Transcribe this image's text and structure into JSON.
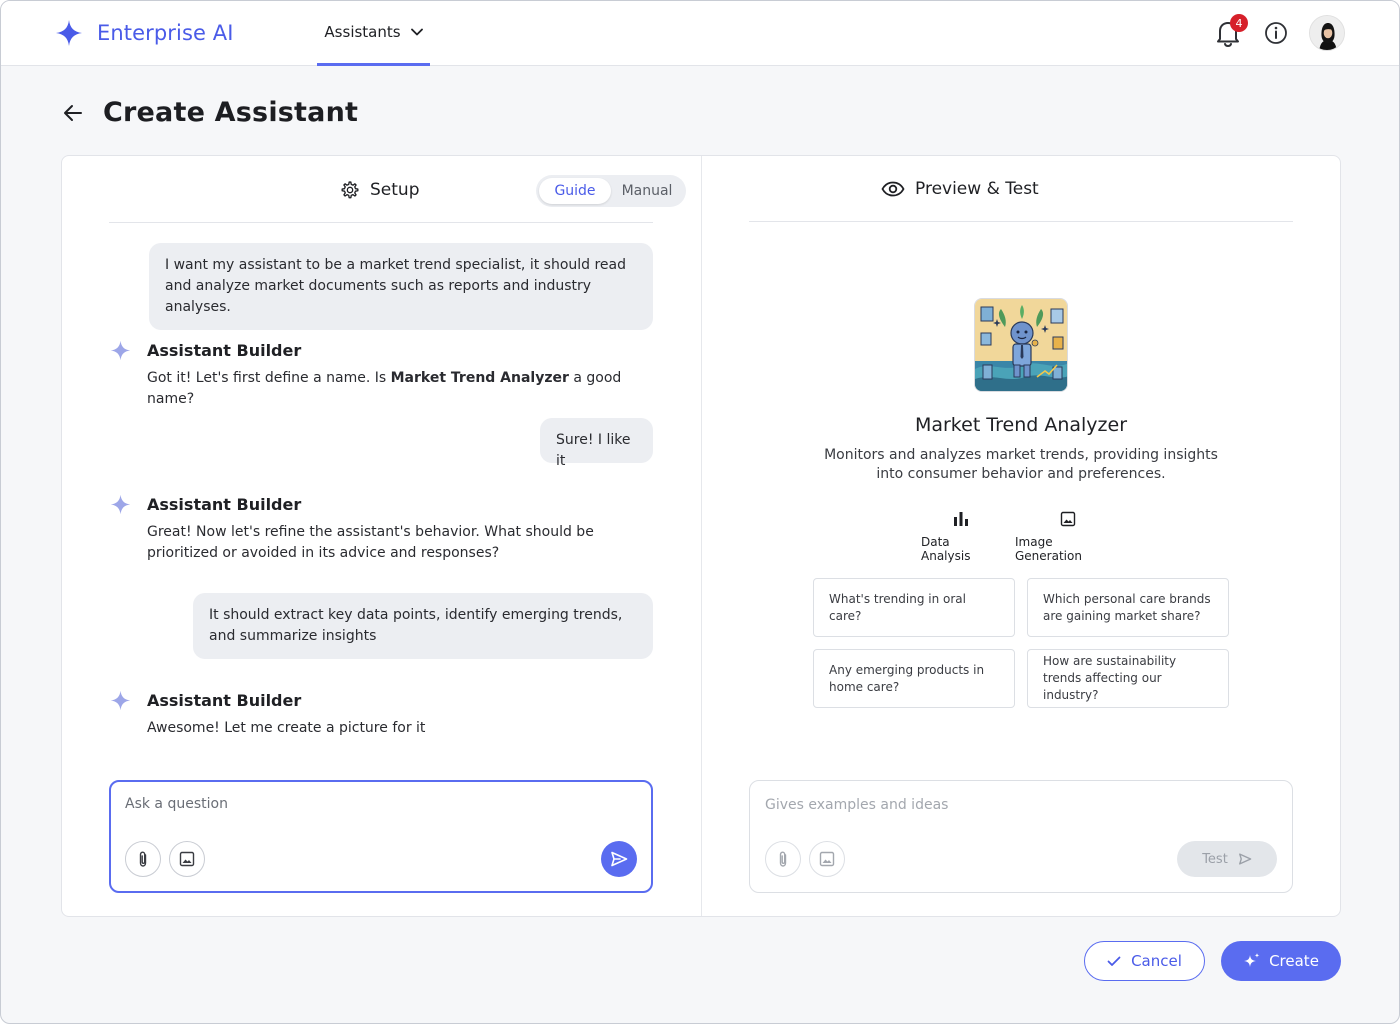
{
  "header": {
    "brand": "Enterprise AI",
    "nav_tab": "Assistants",
    "notification_count": "4"
  },
  "page": {
    "title": "Create Assistant"
  },
  "setup": {
    "title": "Setup",
    "modes": [
      "Guide",
      "Manual"
    ],
    "active_mode": "Guide",
    "messages": [
      {
        "role": "user",
        "text": "I want my assistant to be a market trend specialist, it should read and analyze market documents such as reports and industry analyses."
      },
      {
        "role": "assistant",
        "name": "Assistant Builder",
        "text_before": "Got it! Let's first define a name. Is ",
        "bold": "Market Trend Analyzer",
        "text_after": " a good name?"
      },
      {
        "role": "user",
        "text": "Sure! I like it"
      },
      {
        "role": "assistant",
        "name": "Assistant Builder",
        "text": "Great! Now let's refine the assistant's behavior. What should be prioritized or avoided in its advice and responses?"
      },
      {
        "role": "user",
        "text": "It should extract key data points, identify emerging trends, and summarize insights"
      },
      {
        "role": "assistant",
        "name": "Assistant Builder",
        "text": "Awesome! Let me create a picture for it"
      }
    ],
    "input_placeholder": "Ask a question"
  },
  "preview": {
    "title": "Preview & Test",
    "assistant_name": "Market Trend Analyzer",
    "assistant_description": "Monitors and analyzes market trends, providing insights into consumer behavior and preferences.",
    "capabilities": [
      {
        "label": "Data Analysis",
        "icon": "bar-chart-icon"
      },
      {
        "label": "Image Generation",
        "icon": "image-icon"
      }
    ],
    "starter_prompts": [
      "What's trending in oral care?",
      "Which personal care brands are gaining market share?",
      "Any emerging products in home care?",
      "How are sustainability trends affecting our industry?"
    ],
    "test_placeholder": "Gives examples and ideas",
    "test_button": "Test"
  },
  "footer": {
    "cancel": "Cancel",
    "create": "Create"
  },
  "colors": {
    "accent": "#5a6cf0",
    "badge": "#d6202a"
  }
}
